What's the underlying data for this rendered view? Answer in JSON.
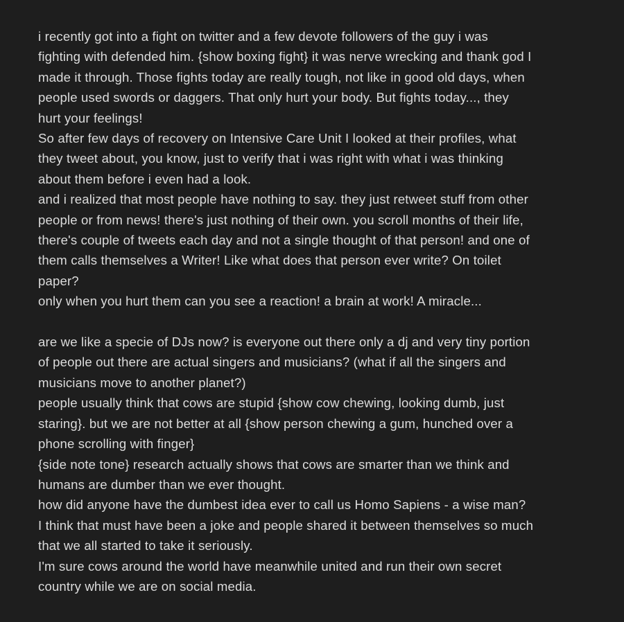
{
  "note": {
    "lines": [
      "i recently got into a fight on twitter and a few devote followers of the guy i was",
      "fighting with defended him. {show boxing fight} it was nerve wrecking and thank god I",
      "made it through. Those fights today are really tough, not like in good old days, when",
      "people used swords or daggers. That only hurt your body. But fights today..., they",
      "hurt your feelings!",
      "So after few days of recovery on Intensive Care Unit I looked at their profiles, what",
      "they tweet about, you know, just to verify that i was right with what i was thinking",
      "about them before i even had a look.",
      "and i realized that most people have nothing to say. they just retweet stuff from other",
      "people or from news! there's just nothing of their own. you scroll months of their life,",
      "there's couple of tweets each day and not a single thought of that person! and one of",
      "them calls themselves a Writer! Like what does that person ever write? On toilet",
      "paper?",
      "only when you hurt them can you see a reaction! a brain at work! A miracle...",
      "",
      "are we like a specie of DJs now? is everyone out there only a dj and very tiny portion",
      "of people out there are actual singers and musicians? (what if all the singers and",
      "musicians move to another planet?)",
      "people usually think that cows are stupid {show cow chewing, looking dumb, just",
      "staring}. but we are not better at all {show person chewing a gum, hunched over a",
      "phone scrolling with finger}",
      "{side note tone} research actually shows that cows are smarter than we think and",
      "humans are dumber than we ever thought.",
      "how did anyone have the dumbest idea ever to call us Homo Sapiens - a wise man?",
      "I think that must have been a joke and people shared it between themselves so much",
      "that we all started to take it seriously.",
      "I'm sure cows around the world have meanwhile united and run their own secret",
      "country while we are on social media."
    ]
  }
}
